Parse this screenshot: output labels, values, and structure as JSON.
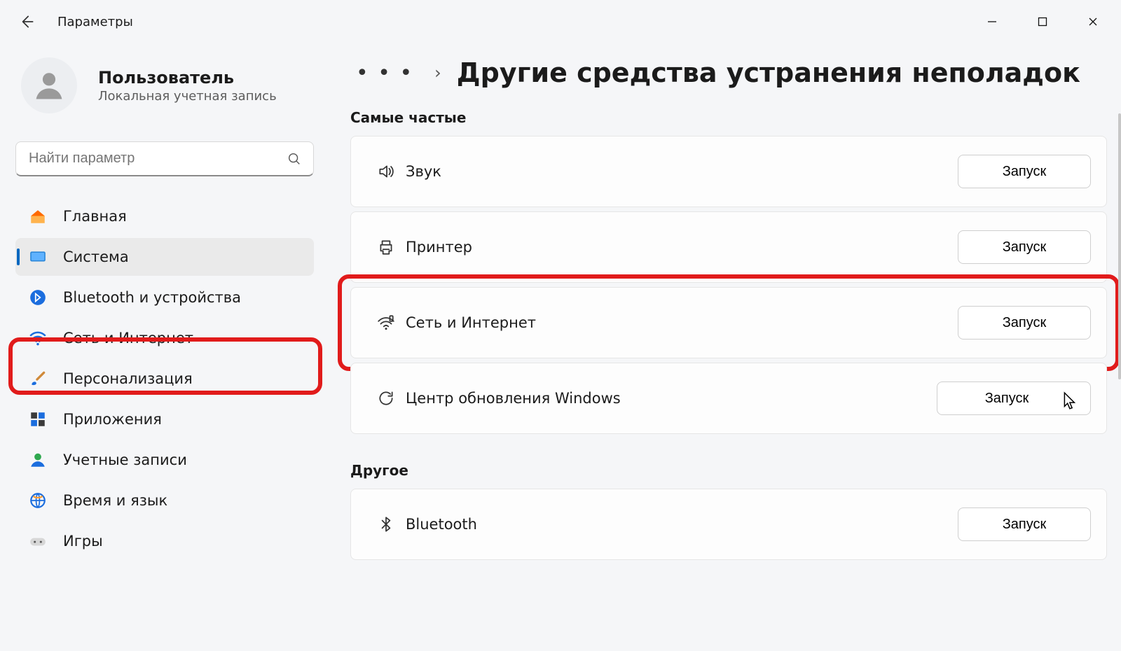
{
  "app_title": "Параметры",
  "user": {
    "name": "Пользователь",
    "subtitle": "Локальная учетная запись"
  },
  "search": {
    "placeholder": "Найти параметр"
  },
  "sidebar": {
    "items": [
      {
        "label": "Главная",
        "icon": "home"
      },
      {
        "label": "Система",
        "icon": "system",
        "selected": true
      },
      {
        "label": "Bluetooth и устройства",
        "icon": "bluetooth"
      },
      {
        "label": "Сеть и Интернет",
        "icon": "wifi"
      },
      {
        "label": "Персонализация",
        "icon": "brush"
      },
      {
        "label": "Приложения",
        "icon": "apps"
      },
      {
        "label": "Учетные записи",
        "icon": "account"
      },
      {
        "label": "Время и язык",
        "icon": "globe"
      },
      {
        "label": "Игры",
        "icon": "gamepad"
      }
    ]
  },
  "breadcrumb": {
    "more": "• • •",
    "sep": "›",
    "title": "Другие средства устранения неполадок"
  },
  "sections": {
    "frequent": {
      "title": "Самые частые",
      "run_label": "Запуск",
      "items": [
        {
          "label": "Звук",
          "icon": "sound"
        },
        {
          "label": "Принтер",
          "icon": "printer"
        },
        {
          "label": "Сеть и Интернет",
          "icon": "network",
          "highlighted": true
        },
        {
          "label": "Центр обновления Windows",
          "icon": "update",
          "cursor": true
        }
      ]
    },
    "other": {
      "title": "Другое",
      "run_label": "Запуск",
      "items": [
        {
          "label": "Bluetooth",
          "icon": "bt2"
        }
      ]
    }
  }
}
